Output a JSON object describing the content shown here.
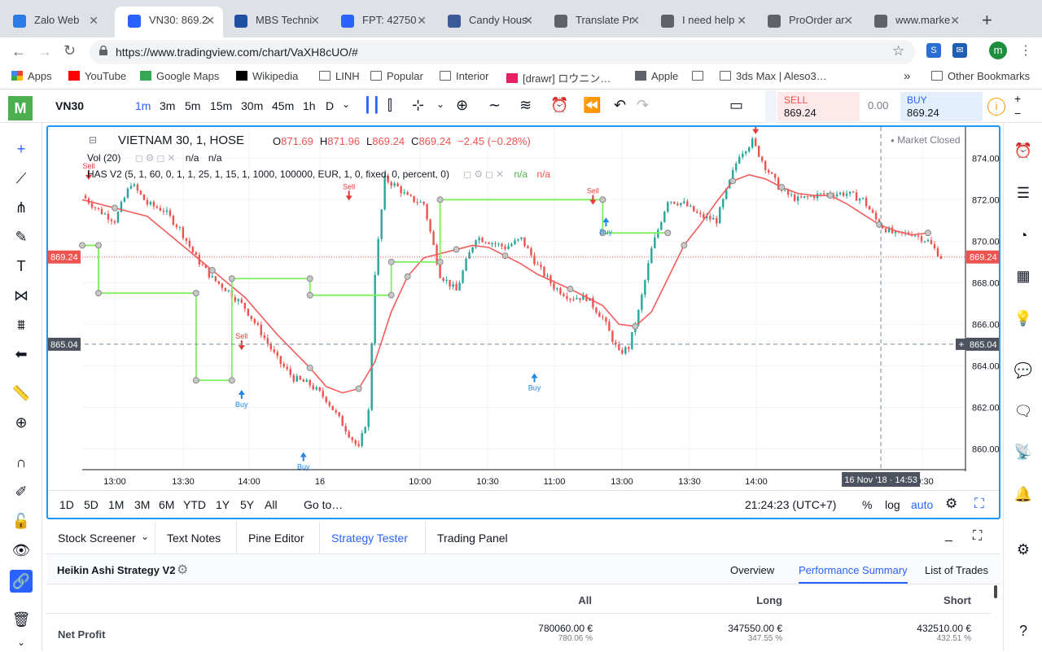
{
  "browser": {
    "tabs": [
      {
        "title": "Zalo Web",
        "icon": "zalo-icon",
        "color": "#2b7ce9",
        "active": false
      },
      {
        "title": "VN30: 869.2",
        "icon": "tradingview-icon",
        "color": "#2962ff",
        "active": true
      },
      {
        "title": "MBS Techni",
        "icon": "mbs-icon",
        "color": "#1e4fa0",
        "active": false
      },
      {
        "title": "FPT: 42750",
        "icon": "tradingview-icon",
        "color": "#2962ff",
        "active": false
      },
      {
        "title": "Candy Hous",
        "icon": "facebook-icon",
        "color": "#3b5998",
        "active": false
      },
      {
        "title": "Translate Pr",
        "icon": "translate-icon",
        "color": "#5f6368",
        "active": false
      },
      {
        "title": "I need help",
        "icon": "document-icon",
        "color": "#5f6368",
        "active": false
      },
      {
        "title": "ProOrder ar",
        "icon": "document-icon",
        "color": "#5f6368",
        "active": false
      },
      {
        "title": "www.marke",
        "icon": "document-icon",
        "color": "#5f6368",
        "active": false
      }
    ],
    "url": "https://www.tradingview.com/chart/VaXH8cUO/#",
    "profile_initial": "m",
    "bookmarks": [
      {
        "label": "Apps",
        "icon": "apps-icon"
      },
      {
        "label": "YouTube",
        "icon": "youtube-icon"
      },
      {
        "label": "Google Maps",
        "icon": "maps-icon"
      },
      {
        "label": "Wikipedia",
        "icon": "wikipedia-icon"
      },
      {
        "label": "LINH",
        "icon": "folder-icon"
      },
      {
        "label": "Popular",
        "icon": "folder-icon"
      },
      {
        "label": "Interior",
        "icon": "folder-icon"
      },
      {
        "label": "[drawr] ロウニン…",
        "icon": "drawr-icon"
      },
      {
        "label": "Apple",
        "icon": "apple-icon"
      },
      {
        "label": "",
        "icon": "document-icon"
      },
      {
        "label": "3ds Max | Aleso3…",
        "icon": "document-icon"
      }
    ],
    "more_bookmarks": "»",
    "other_bookmarks": "Other Bookmarks"
  },
  "tv": {
    "symbol": "VN30",
    "intervals": [
      "1m",
      "3m",
      "5m",
      "15m",
      "30m",
      "45m",
      "1h",
      "D"
    ],
    "active_interval": "1m",
    "sell_label": "SELL",
    "sell_price": "869.24",
    "spread": "0.00",
    "buy_label": "BUY",
    "buy_price": "869.24",
    "legend": {
      "title": "VIETNAM 30, 1, HOSE",
      "o_label": "O",
      "o_val": "871.69",
      "h_label": "H",
      "h_val": "871.96",
      "l_label": "L",
      "l_val": "869.24",
      "c_label": "C",
      "c_val": "869.24",
      "change": "−2.45 (−0.28%)",
      "vol": "Vol (20)",
      "vol_na1": "n/a",
      "vol_na2": "n/a",
      "strategy": "HAS V2 (5, 1, 60, 0, 1, 1, 25, 1, 15, 1, 1000, 100000, EUR, 1, 0, fixed, 0, percent, 0)",
      "strat_na1": "n/a",
      "strat_na2": "n/a",
      "market_status": "Market Closed"
    },
    "ranges": [
      "1D",
      "5D",
      "1M",
      "3M",
      "6M",
      "YTD",
      "1Y",
      "5Y",
      "All"
    ],
    "goto": "Go to…",
    "clock": "21:24:23 (UTC+7)",
    "pct": "%",
    "log": "log",
    "auto": "auto",
    "crosshair_time": "16 Nov '18 · 14:53",
    "crosshair_price": "865.04",
    "last_price": "869.24"
  },
  "chart_data": {
    "type": "candlestick",
    "title": "VIETNAM 30, 1, HOSE",
    "y_ticks": [
      860,
      862,
      864,
      866,
      868,
      870,
      872,
      874
    ],
    "ylim": [
      859.0,
      875.5
    ],
    "x_ticks": [
      "13:00",
      "13:30",
      "14:00",
      "16",
      "10:00",
      "10:30",
      "11:00",
      "13:00",
      "13:30",
      "14:00",
      "09:30"
    ],
    "close_path": [
      [
        0,
        872.2
      ],
      [
        5,
        871.5
      ],
      [
        10,
        871.0
      ],
      [
        15,
        872.8
      ],
      [
        20,
        871.8
      ],
      [
        25,
        871.5
      ],
      [
        30,
        870.6
      ],
      [
        35,
        869.2
      ],
      [
        40,
        868.2
      ],
      [
        45,
        867.6
      ],
      [
        50,
        866.8
      ],
      [
        55,
        865.6
      ],
      [
        60,
        864.3
      ],
      [
        65,
        863.4
      ],
      [
        70,
        863.1
      ],
      [
        75,
        862.4
      ],
      [
        80,
        861.2
      ],
      [
        85,
        860.0
      ],
      [
        88,
        861.8
      ],
      [
        90,
        868.5
      ],
      [
        93,
        873.0
      ],
      [
        97,
        872.6
      ],
      [
        100,
        872.1
      ],
      [
        105,
        871.8
      ],
      [
        110,
        868.4
      ],
      [
        115,
        867.6
      ],
      [
        118,
        869.0
      ],
      [
        121,
        870.2
      ],
      [
        125,
        870.0
      ],
      [
        130,
        869.7
      ],
      [
        135,
        870.1
      ],
      [
        140,
        868.8
      ],
      [
        145,
        867.8
      ],
      [
        150,
        867.3
      ],
      [
        155,
        867.3
      ],
      [
        160,
        866.3
      ],
      [
        165,
        864.6
      ],
      [
        168,
        864.9
      ],
      [
        171,
        866.6
      ],
      [
        175,
        869.6
      ],
      [
        180,
        872.0
      ],
      [
        185,
        871.8
      ],
      [
        190,
        871.2
      ],
      [
        195,
        871.0
      ],
      [
        198,
        872.4
      ],
      [
        202,
        874.2
      ],
      [
        206,
        874.8
      ],
      [
        210,
        873.6
      ],
      [
        215,
        872.4
      ],
      [
        220,
        872.0
      ],
      [
        225,
        872.2
      ],
      [
        230,
        872.3
      ],
      [
        235,
        872.3
      ],
      [
        240,
        872.0
      ],
      [
        245,
        870.8
      ],
      [
        250,
        870.3
      ],
      [
        255,
        870.4
      ],
      [
        260,
        870.0
      ],
      [
        264,
        869.24
      ]
    ],
    "x_span": 264,
    "ema_path": [
      [
        0,
        872.0
      ],
      [
        10,
        871.6
      ],
      [
        20,
        871.2
      ],
      [
        30,
        869.9
      ],
      [
        40,
        868.6
      ],
      [
        50,
        867.3
      ],
      [
        60,
        865.5
      ],
      [
        70,
        863.9
      ],
      [
        75,
        863.0
      ],
      [
        80,
        862.7
      ],
      [
        85,
        862.9
      ],
      [
        90,
        864.2
      ],
      [
        95,
        866.6
      ],
      [
        100,
        868.3
      ],
      [
        105,
        869.2
      ],
      [
        110,
        869.4
      ],
      [
        115,
        869.6
      ],
      [
        120,
        869.8
      ],
      [
        125,
        869.7
      ],
      [
        130,
        869.3
      ],
      [
        135,
        868.9
      ],
      [
        140,
        868.4
      ],
      [
        150,
        867.7
      ],
      [
        160,
        866.9
      ],
      [
        165,
        866.0
      ],
      [
        170,
        865.9
      ],
      [
        175,
        866.6
      ],
      [
        180,
        868.2
      ],
      [
        185,
        869.8
      ],
      [
        190,
        870.8
      ],
      [
        195,
        871.9
      ],
      [
        200,
        872.9
      ],
      [
        205,
        873.2
      ],
      [
        210,
        873.0
      ],
      [
        215,
        872.6
      ],
      [
        220,
        872.3
      ],
      [
        225,
        872.2
      ],
      [
        230,
        872.2
      ],
      [
        235,
        871.8
      ],
      [
        240,
        871.3
      ],
      [
        245,
        870.8
      ],
      [
        250,
        870.5
      ],
      [
        255,
        870.3
      ],
      [
        260,
        870.4
      ]
    ],
    "stop_path": [
      [
        0,
        869.8
      ],
      [
        5,
        869.8
      ],
      [
        5,
        867.5
      ],
      [
        35,
        867.5
      ],
      [
        35,
        863.3
      ],
      [
        46,
        863.3
      ],
      [
        46,
        868.2
      ],
      [
        70,
        868.2
      ],
      [
        70,
        867.4
      ],
      [
        95,
        867.4
      ],
      [
        95,
        869.0
      ],
      [
        110,
        869.0
      ],
      [
        110,
        872.0
      ],
      [
        160,
        872.0
      ],
      [
        160,
        870.4
      ],
      [
        180,
        870.4
      ]
    ],
    "signals": [
      {
        "type": "Sell",
        "x": 2,
        "y": 872.8
      },
      {
        "type": "Sell",
        "x": 49,
        "y": 864.6
      },
      {
        "type": "Buy",
        "x": 49,
        "y": 863.0
      },
      {
        "type": "Buy",
        "x": 68,
        "y": 860.0
      },
      {
        "type": "Sell",
        "x": 82,
        "y": 871.8
      },
      {
        "type": "Buy",
        "x": 139,
        "y": 863.8
      },
      {
        "type": "Sell",
        "x": 157,
        "y": 871.6
      },
      {
        "type": "Buy",
        "x": 161,
        "y": 871.3
      },
      {
        "type": "Sell",
        "x": 207,
        "y": 875.0
      }
    ]
  },
  "bottom": {
    "tabs": [
      "Stock Screener",
      "Text Notes",
      "Pine Editor",
      "Strategy Tester",
      "Trading Panel"
    ],
    "active_tab": "Strategy Tester",
    "strategy_name": "Heikin Ashi Strategy V2",
    "subtabs": [
      "Overview",
      "Performance Summary",
      "List of Trades"
    ],
    "active_subtab": "Performance Summary",
    "columns": [
      "All",
      "Long",
      "Short"
    ],
    "row_label": "Net Profit",
    "all_value": "780060.00 €",
    "all_pct": "780.06 %",
    "long_value": "347550.00 €",
    "long_pct": "347.55 %",
    "short_value": "432510.00 €",
    "short_pct": "432.51 %"
  }
}
